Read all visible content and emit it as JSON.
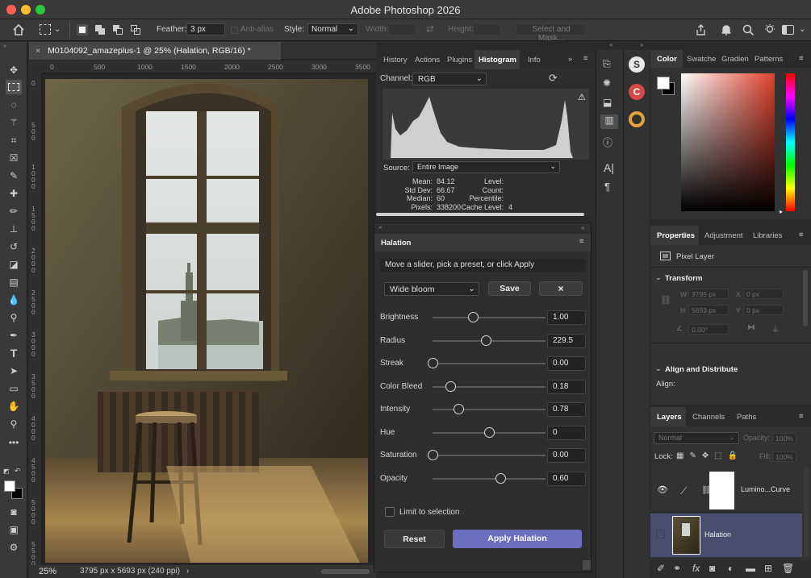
{
  "app": {
    "title": "Adobe Photoshop 2026"
  },
  "colors": {
    "accent": "#6b6fc0",
    "layer_selected": "#4a4e6e",
    "toolbar_bg": "#393939",
    "panel_bg": "#323232"
  },
  "options_bar": {
    "feather_label": "Feather:",
    "feather_value": "3 px",
    "anti_alias_label": "Anti-alias",
    "style_label": "Style:",
    "style_value": "Normal",
    "width_label": "Width:",
    "height_label": "Height:",
    "select_mask_label": "Select and Mask..."
  },
  "document": {
    "tab_title": "M0104092_amazeplus-1 @ 25% (Halation, RGB/16) *",
    "zoom": "25%",
    "info": "3795 px x 5693 px (240 ppi)",
    "ruler_h": [
      "0",
      "500",
      "1000",
      "1500",
      "2000",
      "2500",
      "3000",
      "3500"
    ],
    "ruler_v": [
      "0",
      "500",
      "1000",
      "1500",
      "2000",
      "2500",
      "3000",
      "3500",
      "4000",
      "4500",
      "5000",
      "5500"
    ]
  },
  "histogram_panel": {
    "tabs": [
      "History",
      "Actions",
      "Plugins",
      "Histogram",
      "Info"
    ],
    "channel_label": "Channel:",
    "channel_value": "RGB",
    "source_label": "Source:",
    "source_value": "Entire Image",
    "stats_left": [
      {
        "label": "Mean:",
        "value": "84.12"
      },
      {
        "label": "Std Dev:",
        "value": "66.67"
      },
      {
        "label": "Median:",
        "value": "60"
      },
      {
        "label": "Pixels:",
        "value": "338200"
      }
    ],
    "stats_right": [
      {
        "label": "Level:",
        "value": ""
      },
      {
        "label": "Count:",
        "value": ""
      },
      {
        "label": "Percentile:",
        "value": ""
      },
      {
        "label": "Cache Level:",
        "value": "4"
      }
    ]
  },
  "halation": {
    "title": "Halation",
    "hint": "Move a slider, pick a preset, or click Apply",
    "preset": "Wide bloom",
    "save_label": "Save",
    "close_label": "×",
    "sliders": [
      {
        "label": "Brightness",
        "value": "1.00",
        "pos": 0.36
      },
      {
        "label": "Radius",
        "value": "229.5",
        "pos": 0.47
      },
      {
        "label": "Streak",
        "value": "0.00",
        "pos": 0.0
      },
      {
        "label": "Color Bleed",
        "value": "0.18",
        "pos": 0.16
      },
      {
        "label": "Intensity",
        "value": "0.78",
        "pos": 0.23
      },
      {
        "label": "Hue",
        "value": "0",
        "pos": 0.5
      },
      {
        "label": "Saturation",
        "value": "0.00",
        "pos": 0.0
      },
      {
        "label": "Opacity",
        "value": "0.60",
        "pos": 0.6
      }
    ],
    "limit_label": "Limit to selection",
    "reset_label": "Reset",
    "apply_label": "Apply Halation"
  },
  "color_panel": {
    "tabs": [
      "Color",
      "Swatche",
      "Gradien",
      "Patterns"
    ]
  },
  "properties_panel": {
    "tabs": [
      "Properties",
      "Adjustment",
      "Libraries"
    ],
    "layer_kind": "Pixel Layer",
    "transform_label": "Transform",
    "w_label": "W",
    "w_value": "3795 px",
    "h_label": "H",
    "h_value": "5693 px",
    "x_label": "X",
    "x_value": "0 px",
    "y_label": "Y",
    "y_value": "0 px",
    "angle_value": "0.00°",
    "align_label": "Align and Distribute",
    "align_sub": "Align:"
  },
  "layers_panel": {
    "tabs": [
      "Layers",
      "Channels",
      "Paths"
    ],
    "blend_mode": "Normal",
    "opacity_label": "Opacity:",
    "opacity_value": "100%",
    "lock_label": "Lock:",
    "fill_label": "Fill:",
    "fill_value": "100%",
    "layers": [
      {
        "name": "Lumino...Curve"
      },
      {
        "name": "Halation"
      }
    ]
  }
}
